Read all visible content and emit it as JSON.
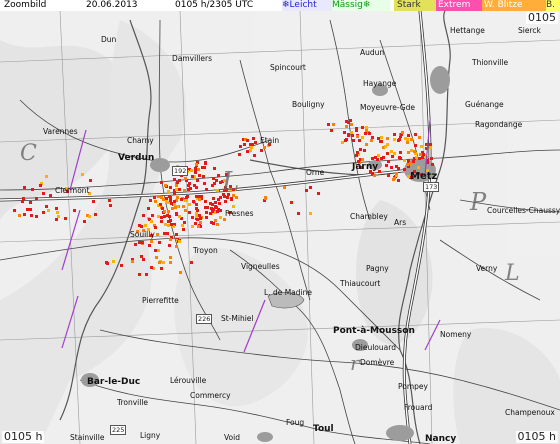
{
  "header": {
    "title": "Zoombild",
    "date": "20.06.2013",
    "time_range": "0105 h/2305 UTC",
    "legend": [
      {
        "label": "Leicht",
        "color": "#3b3bff",
        "icon": "snowflake"
      },
      {
        "label": "Mässig",
        "color": "#19c419",
        "icon": "snowflake"
      },
      {
        "label": "Stark",
        "color": "#d9d900"
      },
      {
        "label": "Extrem",
        "color": "#ff2d9a"
      },
      {
        "label": "W. Blitze",
        "color": "#ff9a00"
      },
      {
        "label": "B.",
        "color": "#ffff00"
      }
    ]
  },
  "corners": {
    "top_right": "0105",
    "bottom_left": "0105 h",
    "bottom_right": "0105 h"
  },
  "places": [
    {
      "name": "Zoombild",
      "big": false
    },
    {
      "name": "Dun"
    },
    {
      "name": "Damvillers"
    },
    {
      "name": "Spincourt"
    },
    {
      "name": "Audun"
    },
    {
      "name": "Hettange"
    },
    {
      "name": "Sierck"
    },
    {
      "name": "Thionville"
    },
    {
      "name": "Hayange"
    },
    {
      "name": "Bouligny"
    },
    {
      "name": "Moyeuvre-Gde"
    },
    {
      "name": "Guénange"
    },
    {
      "name": "Ragondange"
    },
    {
      "name": "Varennes"
    },
    {
      "name": "Charny"
    },
    {
      "name": "Etain"
    },
    {
      "name": "Verdun"
    },
    {
      "name": "Jarny"
    },
    {
      "name": "Metz"
    },
    {
      "name": "Orne"
    },
    {
      "name": "Clermont"
    },
    {
      "name": "Fresnes"
    },
    {
      "name": "Chambley"
    },
    {
      "name": "Ars"
    },
    {
      "name": "Courcelles-Chaussy"
    },
    {
      "name": "Souilly"
    },
    {
      "name": "Troyon"
    },
    {
      "name": "Vigneulles"
    },
    {
      "name": "Pagny"
    },
    {
      "name": "Verny"
    },
    {
      "name": "L. de Madine"
    },
    {
      "name": "Thiaucourt"
    },
    {
      "name": "Pierrefitte"
    },
    {
      "name": "St-Mihiel"
    },
    {
      "name": "Pont-à-Mousson"
    },
    {
      "name": "Nomeny"
    },
    {
      "name": "Dieulouard"
    },
    {
      "name": "Bar-le-Duc"
    },
    {
      "name": "Domèvre"
    },
    {
      "name": "Pompey"
    },
    {
      "name": "Lérouville"
    },
    {
      "name": "Commercy"
    },
    {
      "name": "Tronville"
    },
    {
      "name": "Frouard"
    },
    {
      "name": "Champenoux"
    },
    {
      "name": "Ligny"
    },
    {
      "name": "Stainville"
    },
    {
      "name": "Void"
    },
    {
      "name": "Foug"
    },
    {
      "name": "Toul"
    },
    {
      "name": "Nancy"
    }
  ],
  "roads": [
    "192",
    "173",
    "226",
    "225"
  ],
  "watermark_letters": [
    "C",
    "L",
    "P",
    "L",
    "r"
  ]
}
